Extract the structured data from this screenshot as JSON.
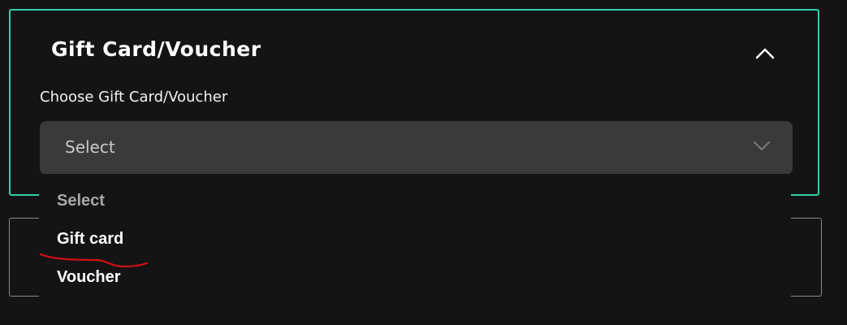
{
  "panel": {
    "title": "Gift Card/Voucher",
    "collapse_icon": "chevron-up-icon",
    "accent_color": "#2fcfa5"
  },
  "field": {
    "label": "Choose Gift Card/Voucher",
    "selected_value": "Select",
    "chevron_icon": "chevron-down-icon"
  },
  "dropdown": {
    "options": [
      "Select",
      "Gift card",
      "Voucher"
    ]
  },
  "annotation": {
    "color": "#d10f14"
  }
}
